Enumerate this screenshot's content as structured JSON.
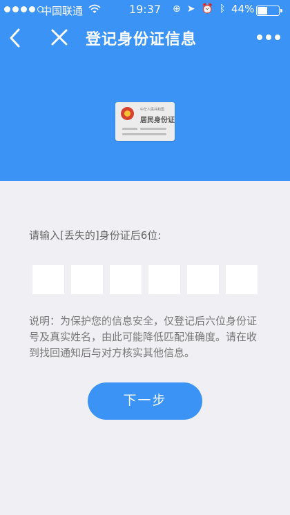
{
  "status_bar": {
    "carrier": "中国联通",
    "time": "19:37",
    "battery": "44%",
    "battery_level": 0.44
  },
  "nav": {
    "title": "登记身份证信息"
  },
  "id_card": {
    "country": "中华人民共和国",
    "title": "居民身份证"
  },
  "form": {
    "prompt": "请输入[丢失的]身份证后6位:",
    "digits": [
      "",
      "",
      "",
      "",
      "",
      ""
    ],
    "description": "说明：为保护您的信息安全，仅登记后六位身份证号及真实姓名，由此可能降低匹配准确度。请在收到找回通知后与对方核实其他信息。",
    "next_label": "下一步"
  },
  "colors": {
    "primary": "#3b93f6",
    "background": "#efeff4"
  }
}
